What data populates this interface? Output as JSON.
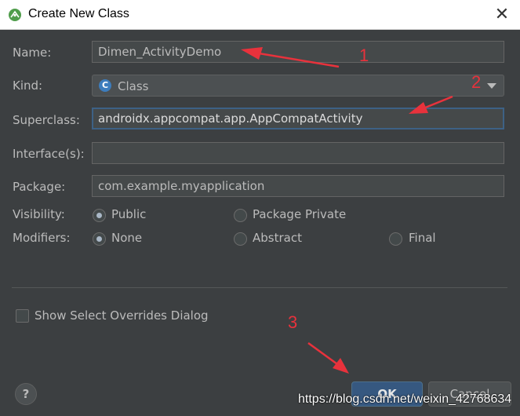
{
  "window": {
    "title": "Create New Class",
    "close_glyph": "✕"
  },
  "form": {
    "name": {
      "label": "Name:",
      "value": "Dimen_ActivityDemo"
    },
    "kind": {
      "label": "Kind:",
      "value": "Class",
      "icon_letter": "C",
      "icon_color": "#3d7dbd"
    },
    "superclass": {
      "label": "Superclass:",
      "value": "androidx.appcompat.app.AppCompatActivity"
    },
    "interfaces": {
      "label": "Interface(s):",
      "value": ""
    },
    "package": {
      "label": "Package:",
      "value": "com.example.myapplication"
    },
    "visibility": {
      "label": "Visibility:",
      "options": [
        "Public",
        "Package Private"
      ],
      "selected": "Public"
    },
    "modifiers": {
      "label": "Modifiers:",
      "options": [
        "None",
        "Abstract",
        "Final"
      ],
      "selected": "None"
    },
    "show_overrides": {
      "label": "Show Select Overrides Dialog",
      "checked": false
    }
  },
  "buttons": {
    "help": "?",
    "ok": "OK",
    "cancel": "Cancel"
  },
  "annotations": {
    "one": "1",
    "two": "2",
    "three": "3",
    "color": "#e8323c"
  },
  "watermark": "https://blog.csdn.net/weixin_42768634",
  "colors": {
    "background": "#3c3f41",
    "focus_border": "#3d6185",
    "ok_button": "#365880"
  }
}
